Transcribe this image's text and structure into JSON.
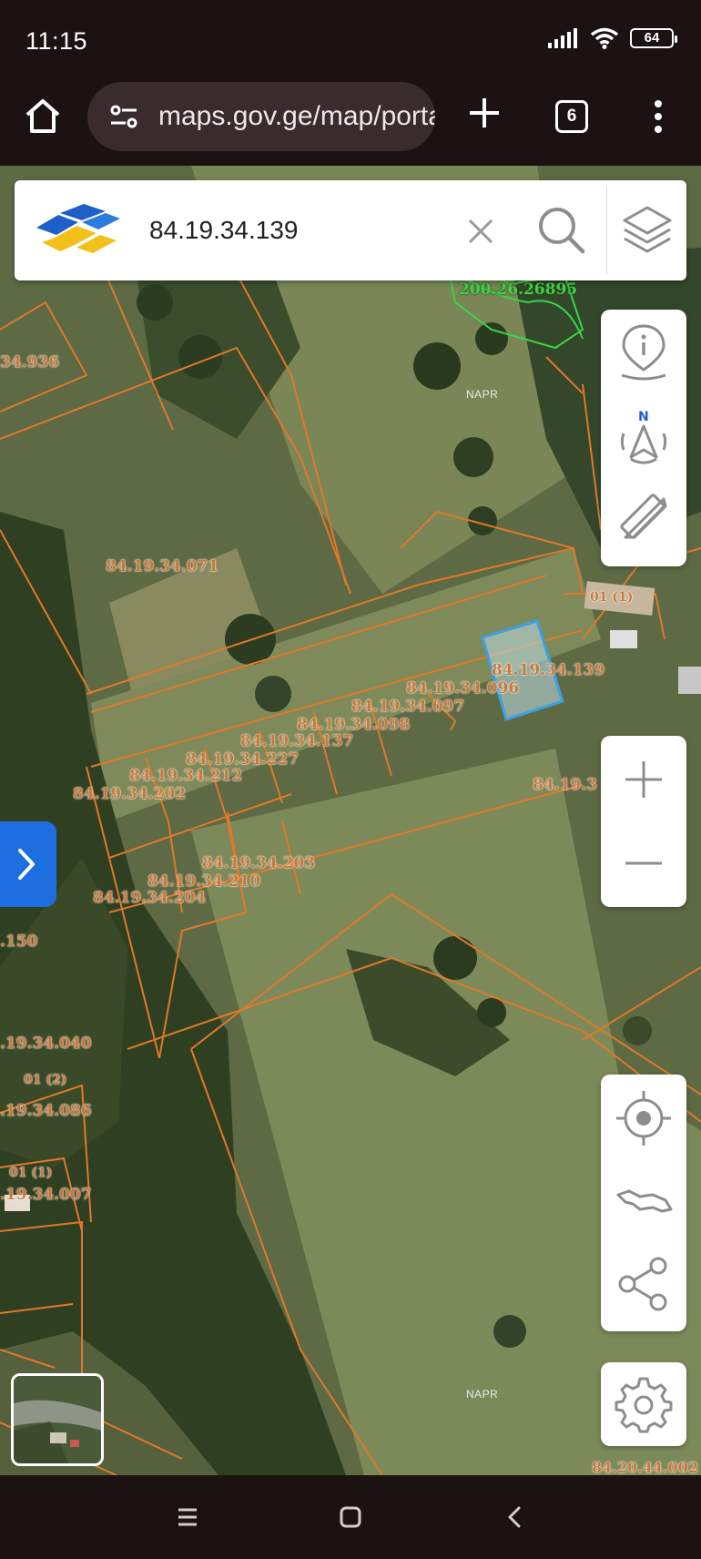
{
  "status_bar": {
    "time": "11:15",
    "battery": "64",
    "icons": [
      "signal-icon",
      "wifi-icon",
      "battery-icon"
    ]
  },
  "browser": {
    "url": "maps.gov.ge/map/portal",
    "tab_count": "6",
    "icons": [
      "home-icon",
      "site-settings-icon",
      "plus-icon",
      "more-vert-icon"
    ]
  },
  "search": {
    "value": "84.19.34.139",
    "icons": [
      "napr-logo",
      "close-icon",
      "search-icon",
      "layers-icon"
    ]
  },
  "map": {
    "watermark": "NAPR",
    "parcels": [
      {
        "id": "p34936",
        "label": "34.936"
      },
      {
        "id": "p071",
        "label": "84.19.34.071"
      },
      {
        "id": "p139",
        "label": "84.19.34.139"
      },
      {
        "id": "p096",
        "label": "84.19.34.096"
      },
      {
        "id": "p097",
        "label": "84.19.34.097"
      },
      {
        "id": "p098",
        "label": "84.19.34.098"
      },
      {
        "id": "p137",
        "label": "84.19.34.137"
      },
      {
        "id": "p227",
        "label": "84.19.34.227"
      },
      {
        "id": "p212",
        "label": "84.19.34.212"
      },
      {
        "id": "p202",
        "label": "84.19.34.202"
      },
      {
        "id": "p203",
        "label": "84.19.34.203"
      },
      {
        "id": "p210",
        "label": "84.19.34.210"
      },
      {
        "id": "p204",
        "label": "84.19.34.204"
      },
      {
        "id": "p84193",
        "label": "84.19.3"
      },
      {
        "id": "p150",
        "label": ".150"
      },
      {
        "id": "p040",
        "label": ".19.34.040"
      },
      {
        "id": "p012",
        "label": "01 (2)"
      },
      {
        "id": "p086",
        "label": ".19.34.086"
      },
      {
        "id": "p011a",
        "label": "01 (1)"
      },
      {
        "id": "p007",
        "label": ".19.34.007"
      },
      {
        "id": "p011b",
        "label": "01 (1)"
      },
      {
        "id": "p200",
        "label": "200.26.26895"
      },
      {
        "id": "p2044",
        "label": "84.20.44.002"
      }
    ],
    "controls": [
      "info-location-icon",
      "compass-north-icon",
      "measure-tool-icon",
      "zoom-in-icon",
      "zoom-out-icon",
      "my-location-icon",
      "georgia-map-icon",
      "share-icon",
      "settings-icon",
      "chevron-right-icon",
      "basemap-thumbnail"
    ],
    "compass_label": "N"
  },
  "nav": {
    "icons": [
      "recent-apps-icon",
      "home-nav-icon",
      "back-icon"
    ]
  }
}
